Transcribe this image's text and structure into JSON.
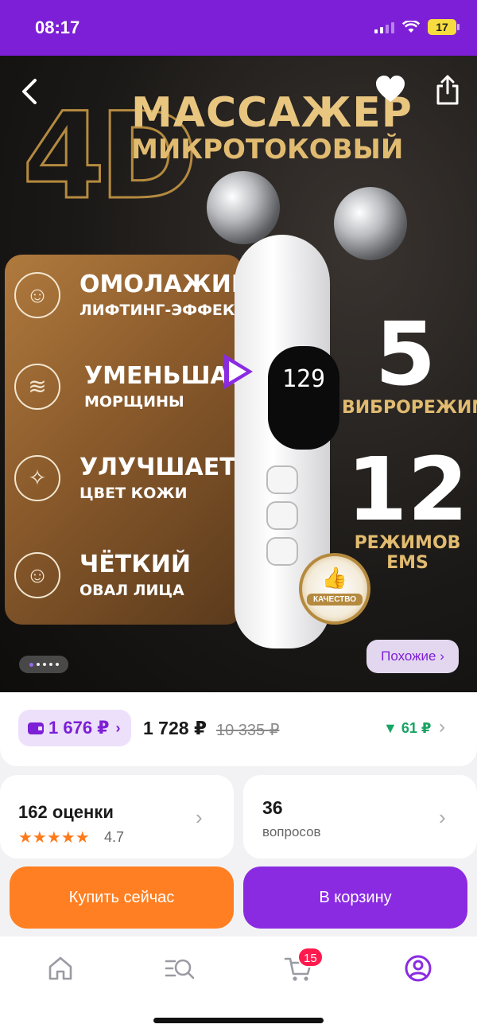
{
  "status": {
    "time": "08:17",
    "battery": "17"
  },
  "hero": {
    "headline_big": "4D",
    "headline_1": "МАССАЖЕР",
    "headline_2": "МИКРОТОКОВЫЙ",
    "features": [
      {
        "main": "ОМОЛАЖИВАЕТ",
        "sub": "ЛИФТИНГ-ЭФФЕКТ",
        "icon": "face-icon"
      },
      {
        "main": "УМЕНЬШАЕТ",
        "sub": "МОРЩИНЫ",
        "icon": "skin-layers-icon"
      },
      {
        "main": "УЛУЧШАЕТ",
        "sub": "ЦВЕТ КОЖИ",
        "icon": "profile-sparkle-icon"
      },
      {
        "main": "ЧЁТКИЙ",
        "sub": "ОВАЛ ЛИЦА",
        "icon": "face-oval-icon"
      }
    ],
    "device_display": "129",
    "stat1": {
      "num": "5",
      "label": "ВИБРОРЕЖИМОВ"
    },
    "stat2": {
      "num": "12",
      "label": "РЕЖИМОВ EMS"
    },
    "quality_badge": "КАЧЕСТВО",
    "similar_button": "Похожие ›"
  },
  "price": {
    "wallet_price": "1 676 ₽",
    "wallet_chevron": "›",
    "current": "1 728 ₽",
    "old": "10 335 ₽",
    "drop": "▼ 61 ₽",
    "chevron": "›"
  },
  "reviews": {
    "title": "162 оценки",
    "stars": "★★★★★",
    "value": "4.7",
    "chevron": "›"
  },
  "questions": {
    "count": "36",
    "label": "вопросов",
    "chevron": "›"
  },
  "actions": {
    "buy_now": "Купить сейчас",
    "add_to_cart": "В корзину"
  },
  "tabbar": {
    "cart_badge": "15"
  },
  "colors": {
    "brand": "#7d1fd6",
    "accent_orange": "#ff7f22",
    "button_purple": "#8a2be2",
    "price_drop_green": "#19a463",
    "star_orange": "#ff7a1a",
    "badge_red": "#ff1a4d"
  }
}
